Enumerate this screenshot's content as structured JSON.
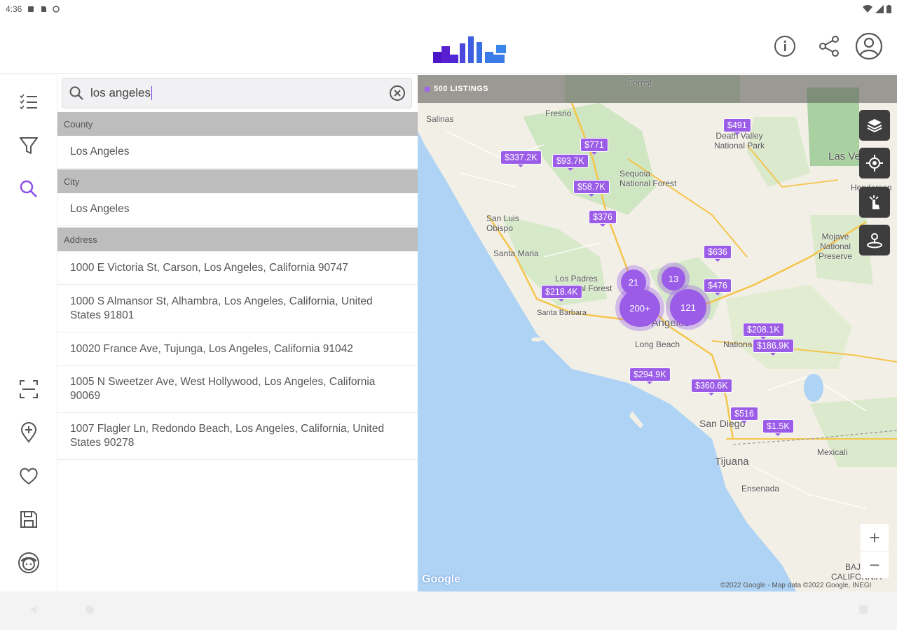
{
  "status_bar": {
    "time": "4:36"
  },
  "search": {
    "query": "los angeles"
  },
  "sections": [
    {
      "header": "County",
      "items": [
        "Los Angeles"
      ]
    },
    {
      "header": "City",
      "items": [
        "Los Angeles"
      ]
    },
    {
      "header": "Address",
      "items": [
        "1000 E Victoria St, Carson, Los Angeles, California 90747",
        "1000 S Almansor St, Alhambra, Los Angeles, California, United States 91801",
        "10020 France Ave, Tujunga, Los Angeles, California 91042",
        "1005 N Sweetzer Ave, West Hollywood, Los Angeles, California 90069",
        "1007 Flagler Ln, Redondo Beach, Los Angeles, California, United States 90278"
      ]
    }
  ],
  "map": {
    "listings_label": "500 LISTINGS",
    "prices": [
      "$491",
      "$771",
      "$337.2K",
      "$93.7K",
      "$58.7K",
      "$376",
      "$636",
      "$476",
      "$218.4K",
      "$208.1K",
      "$186.9K",
      "$294.9K",
      "$360.6K",
      "$516",
      "$1.5K"
    ],
    "clusters": [
      "21",
      "13",
      "200+",
      "121"
    ],
    "places": [
      "Forest",
      "Fresno",
      "Salinas",
      "Death Valley National Park",
      "Las Vegas",
      "Sequoia National Forest",
      "San Luis Obispo",
      "Santa Maria",
      "Mojave National Preserve",
      "Los Padres National Forest",
      "Santa Barbara",
      "Los Angeles",
      "Long Beach",
      "San Diego",
      "Tijuana",
      "Mexicali",
      "Ensenada",
      "BAJA CALIFORNIA",
      "National Park",
      "Henderson"
    ],
    "attribution": "©2022 Google - Map data ©2022 Google, INEGI",
    "google": "Google",
    "zoom_in": "+",
    "zoom_out": "−"
  },
  "colors": {
    "accent": "#9b5ce8",
    "brand_purple": "#5a1fd0",
    "brand_blue": "#3a7be8"
  }
}
